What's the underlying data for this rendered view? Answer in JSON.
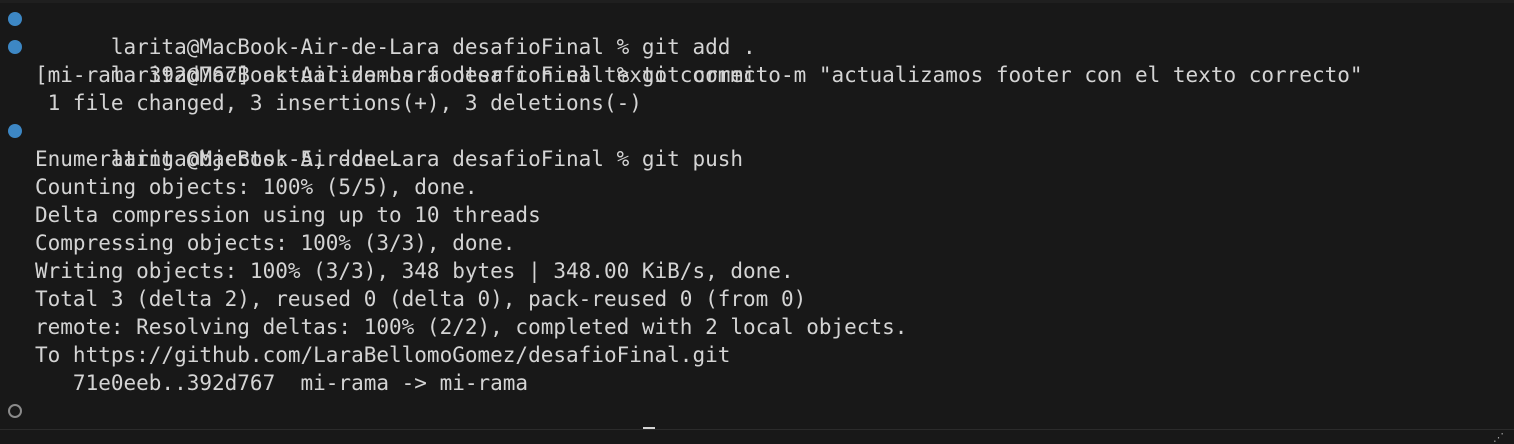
{
  "terminal": {
    "prompt": "larita@MacBook-Air-de-Lara desafioFinal % ",
    "lines": [
      {
        "type": "command",
        "status": "success",
        "command": "git add ."
      },
      {
        "type": "command",
        "status": "success",
        "command": "git commit -m \"actualizamos footer con el texto correcto\""
      },
      {
        "type": "output",
        "text": "[mi-rama 392d767] actualizamos footer con el texto correcto"
      },
      {
        "type": "output",
        "text": " 1 file changed, 3 insertions(+), 3 deletions(-)"
      },
      {
        "type": "command",
        "status": "success",
        "command": "git push"
      },
      {
        "type": "output",
        "text": "Enumerating objects: 5, done."
      },
      {
        "type": "output",
        "text": "Counting objects: 100% (5/5), done."
      },
      {
        "type": "output",
        "text": "Delta compression using up to 10 threads"
      },
      {
        "type": "output",
        "text": "Compressing objects: 100% (3/3), done."
      },
      {
        "type": "output",
        "text": "Writing objects: 100% (3/3), 348 bytes | 348.00 KiB/s, done."
      },
      {
        "type": "output",
        "text": "Total 3 (delta 2), reused 0 (delta 0), pack-reused 0 (from 0)"
      },
      {
        "type": "output",
        "text": "remote: Resolving deltas: 100% (2/2), completed with 2 local objects."
      },
      {
        "type": "output",
        "text": "To https://github.com/LaraBellomoGomez/desafioFinal.git"
      },
      {
        "type": "output",
        "text": "   71e0eeb..392d767  mi-rama -> mi-rama"
      },
      {
        "type": "command",
        "status": "idle",
        "command": ""
      }
    ]
  },
  "colors": {
    "background": "#181818",
    "foreground": "#d4d4d4",
    "success_decoration": "#3d87c4",
    "idle_decoration": "#8a8a8a"
  },
  "icons": {
    "success_decoration": "command-success-circle-icon",
    "idle_decoration": "command-idle-circle-icon",
    "cursor": "block-cursor-icon"
  }
}
